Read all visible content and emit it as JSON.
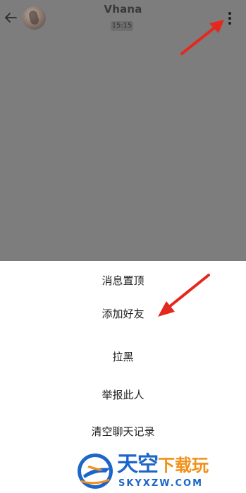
{
  "header": {
    "back_icon": "arrow-left-icon",
    "title": "Vhana",
    "time": "15:15",
    "more_icon": "more-vertical-icon"
  },
  "menu": {
    "items": [
      {
        "label": "消息置顶"
      },
      {
        "label": "添加好友"
      },
      {
        "label": "拉黑"
      },
      {
        "label": "举报此人"
      },
      {
        "label": "清空聊天记录"
      }
    ]
  },
  "watermark": {
    "title_main": "天空",
    "title_accent": "下载玩",
    "subtitle": "SKYXZW.COM"
  },
  "colors": {
    "overlay": "#7d7d7d",
    "annotation_arrow": "#e5281e",
    "watermark_blue": "#1d66c9",
    "watermark_orange": "#f29018"
  }
}
